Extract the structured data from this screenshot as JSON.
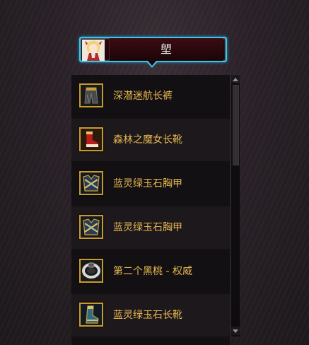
{
  "header": {
    "title": "塱"
  },
  "items": [
    {
      "label": "深潜迷航长裤",
      "icon": "pants-icon"
    },
    {
      "label": "森林之魔女长靴",
      "icon": "boots-icon"
    },
    {
      "label": "蓝灵绿玉石胸甲",
      "icon": "chest-armor-icon"
    },
    {
      "label": "蓝灵绿玉石胸甲",
      "icon": "chest-armor-icon"
    },
    {
      "label": "第二个黑桃 - 权威",
      "icon": "ring-icon"
    },
    {
      "label": "蓝灵绿玉石长靴",
      "icon": "boots-icon"
    }
  ],
  "colors": {
    "accent": "#3fc3e8",
    "item_name": "#e8b850",
    "icon_border": "#c99a2a"
  }
}
